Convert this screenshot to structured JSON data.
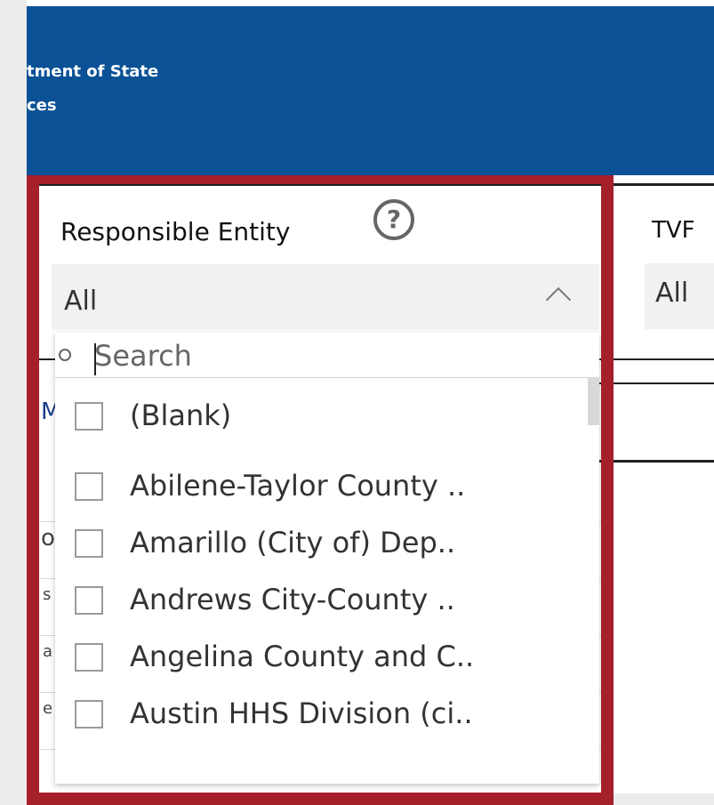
{
  "banner": {
    "line1": "tment of State",
    "line2": "ces"
  },
  "filter": {
    "label": "Responsible Entity",
    "help_glyph": "?",
    "selected_value": "All",
    "search_placeholder": "Search",
    "options": [
      "(Blank)",
      "Abilene-Taylor County ..",
      "Amarillo (City of) Dep..",
      "Andrews City-County ..",
      "Angelina County and C..",
      "Austin HHS Division (ci.."
    ]
  },
  "tvf": {
    "label": "TVF",
    "value": "All"
  },
  "background_fragments": [
    "M",
    "o",
    "s",
    "a",
    "e"
  ],
  "colors": {
    "banner": "#0b5196",
    "highlight_border": "#a5202a"
  }
}
